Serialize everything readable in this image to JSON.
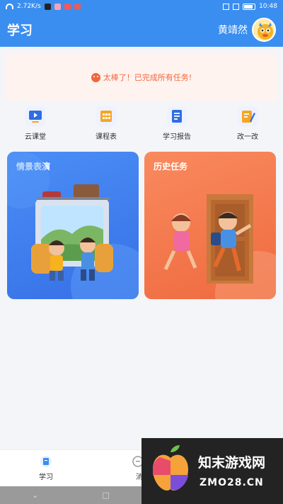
{
  "status_bar": {
    "speed": "2.72K/s",
    "time": "10:48"
  },
  "header": {
    "title": "学习",
    "username": "黄靖然"
  },
  "banner": {
    "message": "太棒了！已完成所有任务!"
  },
  "quick_nav": [
    {
      "label": "云课堂",
      "icon": "video-play-icon"
    },
    {
      "label": "课程表",
      "icon": "calendar-grid-icon"
    },
    {
      "label": "学习报告",
      "icon": "report-document-icon"
    },
    {
      "label": "改一改",
      "icon": "edit-pencil-icon"
    }
  ],
  "cards": {
    "scene": {
      "title": "情景表演"
    },
    "history": {
      "title": "历史任务"
    }
  },
  "bottom_nav": {
    "study": "学习",
    "message_partial": "消"
  },
  "watermark": {
    "line1": "知末游戏网",
    "line2": "ZMO28.CN"
  },
  "colors": {
    "primary": "#3a8ef0",
    "accent": "#f0673b",
    "card_blue": "#3f7ef0",
    "card_orange": "#f57a4c"
  }
}
